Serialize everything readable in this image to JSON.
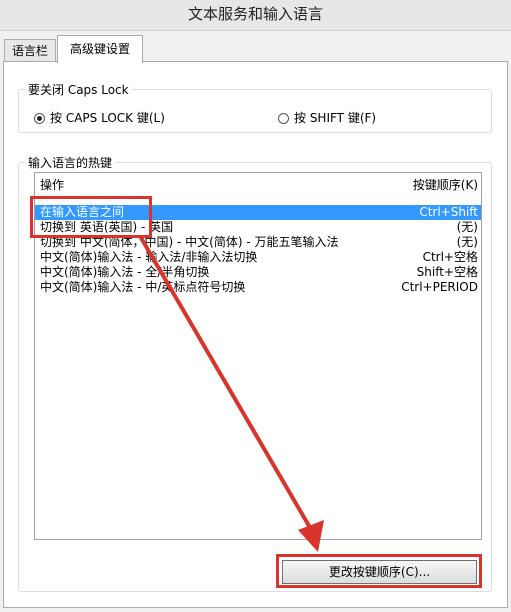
{
  "window": {
    "title": "文本服务和输入语言"
  },
  "tabs": [
    {
      "label": "语言栏"
    },
    {
      "label": "高级键设置"
    }
  ],
  "caps_lock": {
    "legend": "要关闭 Caps Lock",
    "option1": "按 CAPS LOCK 键(L)",
    "option2": "按 SHIFT 键(F)"
  },
  "hotkeys": {
    "legend": "输入语言的热键",
    "col_action": "操作",
    "col_sequence": "按键顺序(K)",
    "rows": [
      {
        "action": "在输入语言之间",
        "sequence": "Ctrl+Shift"
      },
      {
        "action": "切换到 英语(英国) - 英国",
        "sequence": "(无)"
      },
      {
        "action": "切换到 中文(简体，中国) - 中文(简体) - 万能五笔输入法",
        "sequence": "(无)"
      },
      {
        "action": "中文(简体)输入法 - 输入法/非输入法切换",
        "sequence": "Ctrl+空格"
      },
      {
        "action": "中文(简体)输入法 - 全/半角切换",
        "sequence": "Shift+空格"
      },
      {
        "action": "中文(简体)输入法 - 中/英标点符号切换",
        "sequence": "Ctrl+PERIOD"
      }
    ]
  },
  "buttons": {
    "change_sequence": "更改按键顺序(C)..."
  },
  "colors": {
    "selection": "#3399ff",
    "annotation": "#d9342b"
  }
}
